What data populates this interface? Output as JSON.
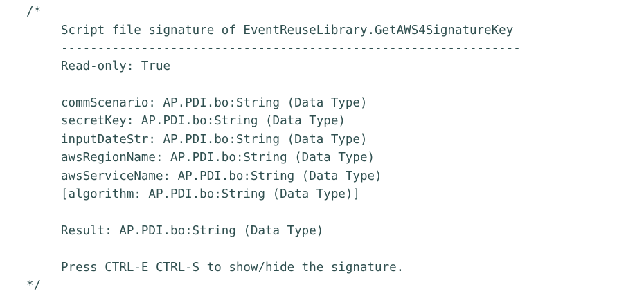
{
  "code": {
    "comment_open": "/*",
    "comment_close": "*/",
    "title": "Script file signature of EventReuseLibrary.GetAWS4SignatureKey",
    "separator": "---------------------------------------------------------------",
    "read_only": "Read-only: True",
    "parameters": [
      "commScenario: AP.PDI.bo:String (Data Type)",
      "secretKey: AP.PDI.bo:String (Data Type)",
      "inputDateStr: AP.PDI.bo:String (Data Type)",
      "awsRegionName: AP.PDI.bo:String (Data Type)",
      "awsServiceName: AP.PDI.bo:String (Data Type)",
      "[algorithm: AP.PDI.bo:String (Data Type)]"
    ],
    "result": "Result: AP.PDI.bo:String (Data Type)",
    "hint": "Press CTRL-E CTRL-S to show/hide the signature."
  }
}
